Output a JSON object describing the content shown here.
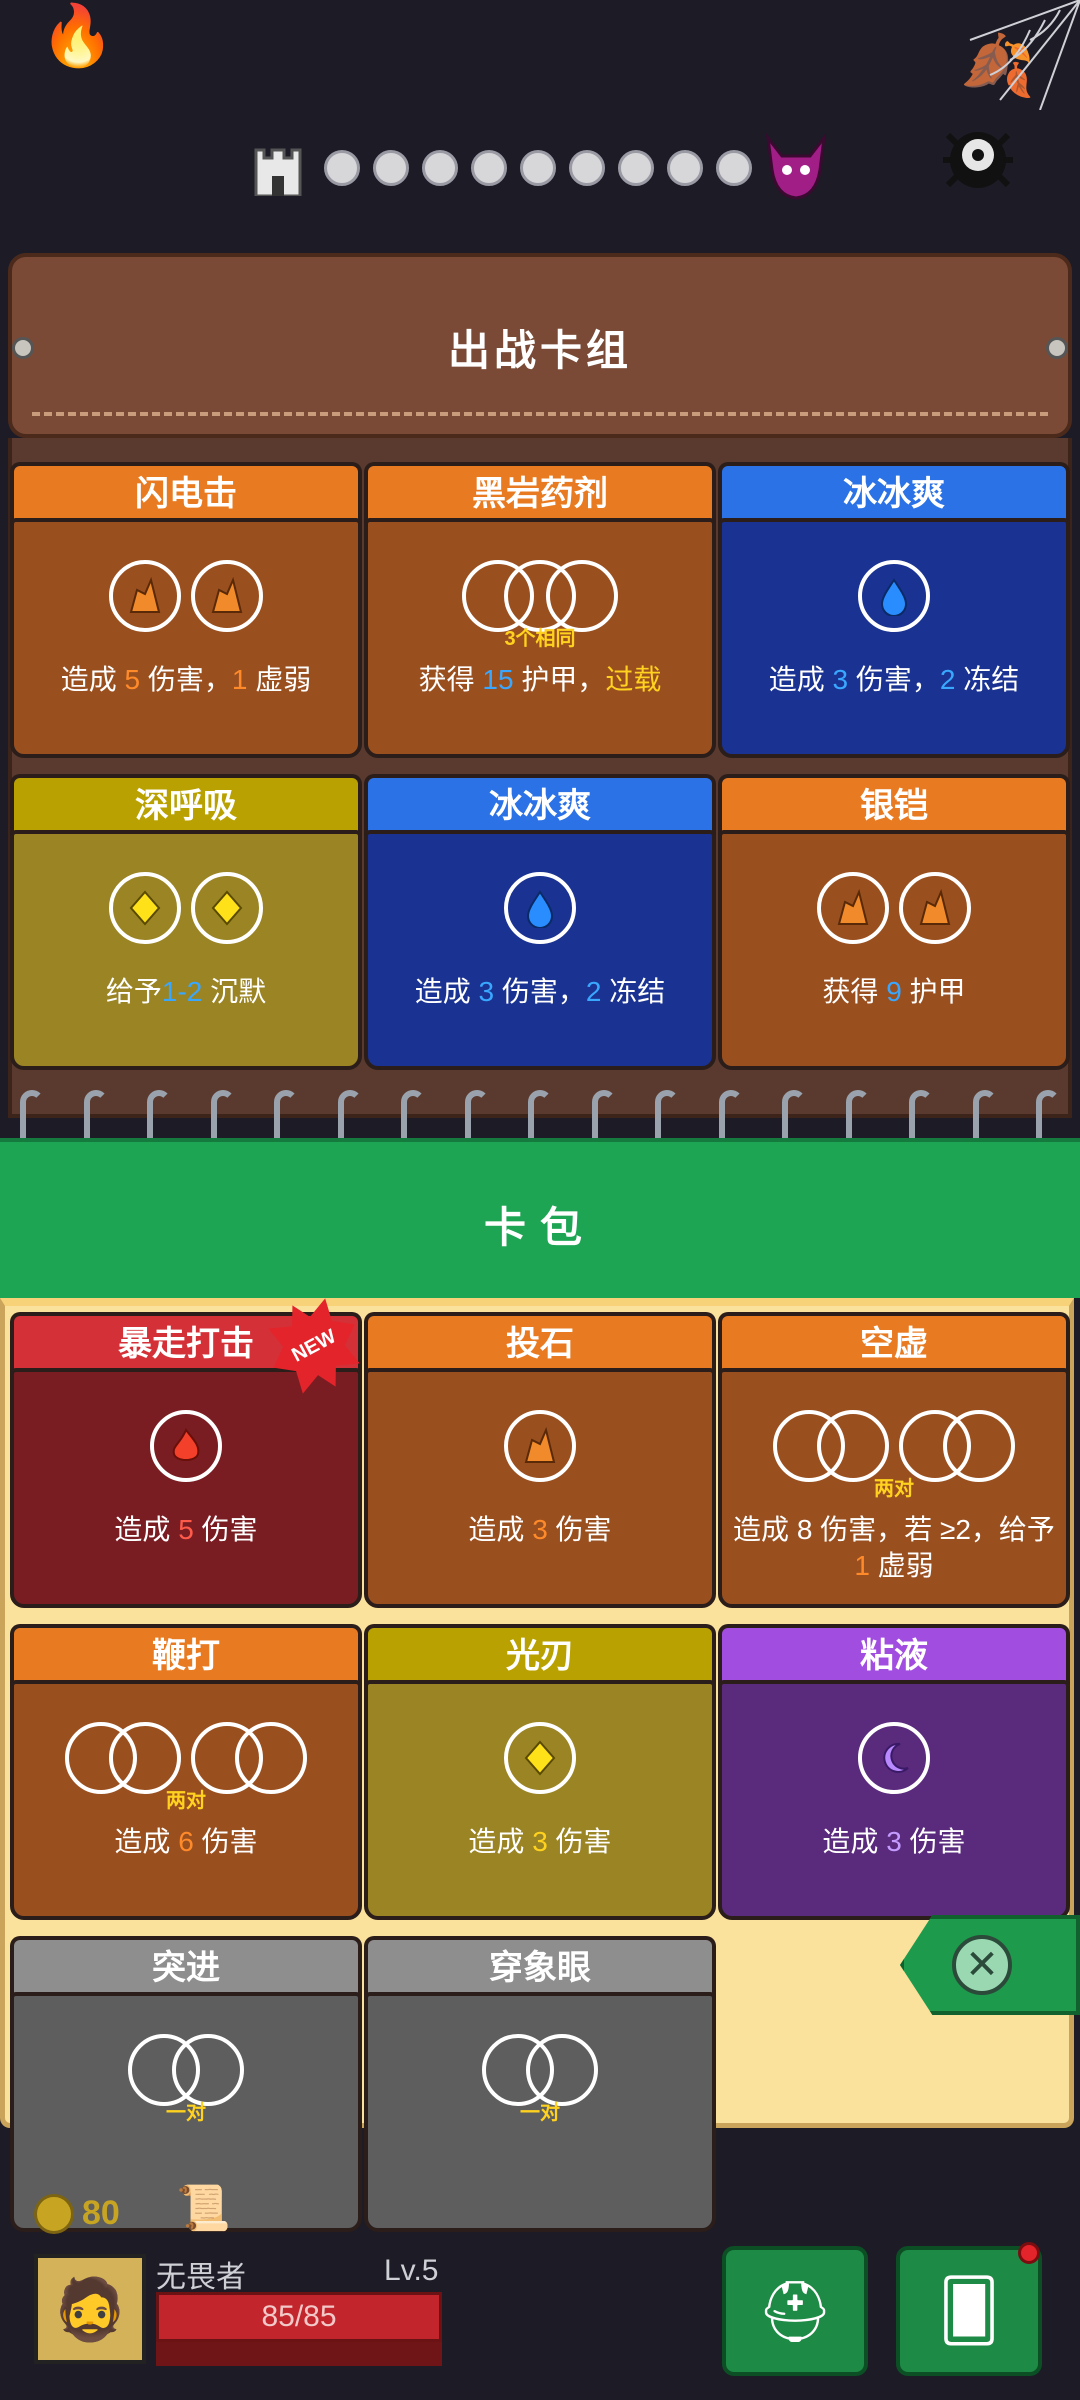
{
  "deck": {
    "title": "出战卡组",
    "cards": [
      {
        "color": "orange",
        "name": "闪电击",
        "icons": [
          "rock",
          "rock"
        ],
        "sub": "",
        "desc_parts": [
          [
            "造成 ",
            ""
          ],
          [
            "5",
            "orange"
          ],
          [
            " 伤害，",
            ""
          ],
          [
            "1",
            "orange"
          ],
          [
            " 虚弱",
            ""
          ]
        ]
      },
      {
        "color": "orange",
        "name": "黑岩药剂",
        "icons": [
          "triple"
        ],
        "sub": "3个相同",
        "desc_parts": [
          [
            "获得 ",
            ""
          ],
          [
            "15",
            "blue"
          ],
          [
            " 护甲，",
            ""
          ],
          [
            "过载",
            "yellow"
          ]
        ]
      },
      {
        "color": "blue",
        "name": "冰冰爽",
        "icons": [
          "drop"
        ],
        "sub": "",
        "desc_parts": [
          [
            "造成 ",
            ""
          ],
          [
            "3",
            "blue"
          ],
          [
            " 伤害，",
            ""
          ],
          [
            "2",
            "blue"
          ],
          [
            " 冻结",
            ""
          ]
        ]
      },
      {
        "color": "yellow",
        "name": "深呼吸",
        "icons": [
          "diamond",
          "diamond"
        ],
        "sub": "",
        "desc_parts": [
          [
            "给予",
            ""
          ],
          [
            "1-2",
            "blue"
          ],
          [
            " 沉默",
            ""
          ]
        ]
      },
      {
        "color": "blue",
        "name": "冰冰爽",
        "icons": [
          "drop"
        ],
        "sub": "",
        "desc_parts": [
          [
            "造成 ",
            ""
          ],
          [
            "3",
            "blue"
          ],
          [
            " 伤害，",
            ""
          ],
          [
            "2",
            "blue"
          ],
          [
            " 冻结",
            ""
          ]
        ]
      },
      {
        "color": "orange",
        "name": "银铠",
        "icons": [
          "rock",
          "rock"
        ],
        "sub": "",
        "desc_parts": [
          [
            "获得 ",
            ""
          ],
          [
            "9",
            "blue"
          ],
          [
            " 护甲",
            ""
          ]
        ]
      }
    ]
  },
  "pack": {
    "title": "卡包",
    "new_badge": "NEW",
    "cards": [
      {
        "color": "red",
        "name": "暴走打击",
        "icons": [
          "fire"
        ],
        "sub": "",
        "desc_parts": [
          [
            "造成 ",
            ""
          ],
          [
            "5",
            "red"
          ],
          [
            " 伤害",
            ""
          ]
        ]
      },
      {
        "color": "orange",
        "name": "投石",
        "icons": [
          "rock"
        ],
        "sub": "",
        "desc_parts": [
          [
            "造成 ",
            ""
          ],
          [
            "3",
            "orange"
          ],
          [
            " 伤害",
            ""
          ]
        ]
      },
      {
        "color": "orange",
        "name": "空虚",
        "icons": [
          "pair",
          "pair"
        ],
        "sub": "两对",
        "desc_parts": [
          [
            "造成 ",
            ""
          ],
          [
            "8",
            ""
          ],
          [
            " 伤害，若 ",
            ""
          ],
          [
            "≥2，",
            ""
          ],
          [
            "给予 ",
            ""
          ],
          [
            "1",
            "orange"
          ],
          [
            " 虚弱",
            ""
          ]
        ]
      },
      {
        "color": "orange",
        "name": "鞭打",
        "icons": [
          "pair",
          "pair"
        ],
        "sub": "两对",
        "desc_parts": [
          [
            "造成 ",
            ""
          ],
          [
            "6",
            "orange"
          ],
          [
            " 伤害",
            ""
          ]
        ]
      },
      {
        "color": "yellow",
        "name": "光刃",
        "icons": [
          "diamond"
        ],
        "sub": "",
        "desc_parts": [
          [
            "造成 ",
            ""
          ],
          [
            "3",
            "yellow"
          ],
          [
            " 伤害",
            ""
          ]
        ]
      },
      {
        "color": "purple",
        "name": "粘液",
        "icons": [
          "moon"
        ],
        "sub": "",
        "desc_parts": [
          [
            "造成 ",
            ""
          ],
          [
            "3",
            "purple"
          ],
          [
            " 伤害",
            ""
          ]
        ]
      },
      {
        "color": "gray",
        "name": "突进",
        "icons": [
          "pair"
        ],
        "sub": "一对",
        "desc_parts": []
      },
      {
        "color": "gray",
        "name": "穿象眼",
        "icons": [
          "pair"
        ],
        "sub": "一对",
        "desc_parts": []
      }
    ]
  },
  "progress": {
    "dots": 9
  },
  "hud": {
    "coins": "80",
    "hero_name": "无畏者",
    "level": "Lv.5",
    "hp": "85/85"
  },
  "icons": {
    "rock": "rock-icon",
    "fire": "fire-icon",
    "drop": "water-drop-icon",
    "diamond": "diamond-icon",
    "moon": "moon-icon"
  }
}
